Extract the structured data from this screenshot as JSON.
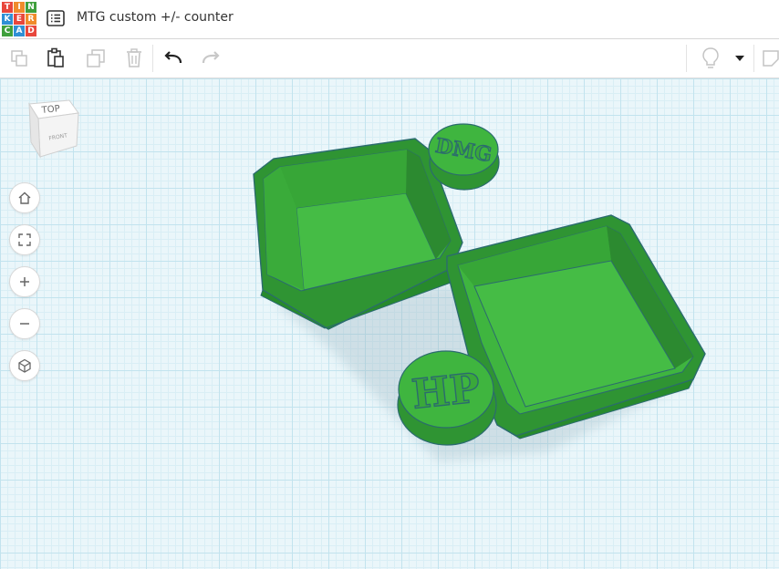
{
  "app": {
    "logo_letters": [
      "T",
      "I",
      "N",
      "K",
      "E",
      "R",
      "C",
      "A",
      "D"
    ],
    "logo_colors": [
      "#e8473c",
      "#f08b2b",
      "#3f9f3c",
      "#2f8fd4",
      "#e8473c",
      "#f08b2b",
      "#3f9f3c",
      "#2f8fd4",
      "#e8473c"
    ],
    "project_title": "MTG custom +/- counter"
  },
  "toolbar": {
    "items": [
      {
        "name": "copy-icon",
        "enabled": false
      },
      {
        "name": "paste-icon",
        "enabled": true
      },
      {
        "name": "duplicate-icon",
        "enabled": false
      },
      {
        "name": "delete-icon",
        "enabled": false
      },
      {
        "name": "undo-icon",
        "enabled": true
      },
      {
        "name": "redo-icon",
        "enabled": false
      },
      {
        "name": "lightbulb-icon",
        "enabled": false
      },
      {
        "name": "chevron-down-icon",
        "enabled": true
      },
      {
        "name": "notes-icon",
        "enabled": false
      }
    ]
  },
  "viewcube": {
    "top_label": "TOP",
    "front_label": "FRONT"
  },
  "nav": [
    {
      "name": "home-view-icon"
    },
    {
      "name": "fit-view-icon"
    },
    {
      "name": "zoom-in-icon"
    },
    {
      "name": "zoom-out-icon"
    },
    {
      "name": "perspective-icon"
    }
  ],
  "model": {
    "color": "#3aa83a",
    "labels": {
      "small_disc": "DMG",
      "large_disc": "HP"
    }
  },
  "colors": {
    "grid_major": "#c2e3ee",
    "grid_minor": "#d9eef5",
    "model_outline": "#2b6b6e"
  }
}
